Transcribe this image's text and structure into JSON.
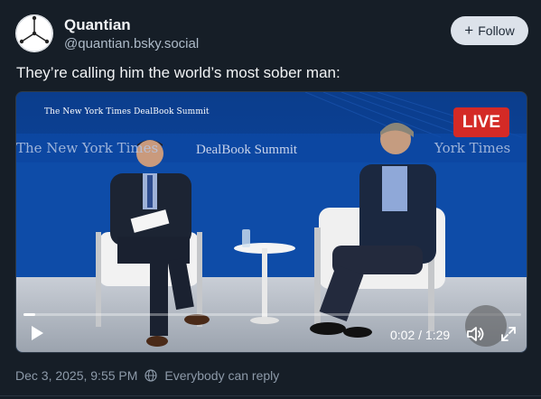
{
  "author": {
    "display_name": "Quantian",
    "handle": "@quantian.bsky.social"
  },
  "follow_button": {
    "label": "Follow"
  },
  "post": {
    "text": "They’re calling him the world’s most sober man:",
    "timestamp": "Dec 3, 2025, 9:55 PM",
    "reply_setting": "Everybody can reply"
  },
  "video": {
    "overlay_small_logo": "The New York Times DealBook Summit",
    "banner_left": "The New York Times",
    "banner_center": "DealBook Summit",
    "banner_right": "York Times",
    "live_badge": "LIVE",
    "time_display": "0:02 / 1:29",
    "progress_fraction": 0.023
  },
  "colors": {
    "background": "#161e27",
    "live_red": "#d42a26",
    "follow_bg": "#dce2ea"
  },
  "icons": {
    "avatar": "quantian-logo",
    "play": "play-icon",
    "mute": "speaker-muted-icon",
    "fullscreen": "fullscreen-icon",
    "reply": "globe-icon"
  }
}
